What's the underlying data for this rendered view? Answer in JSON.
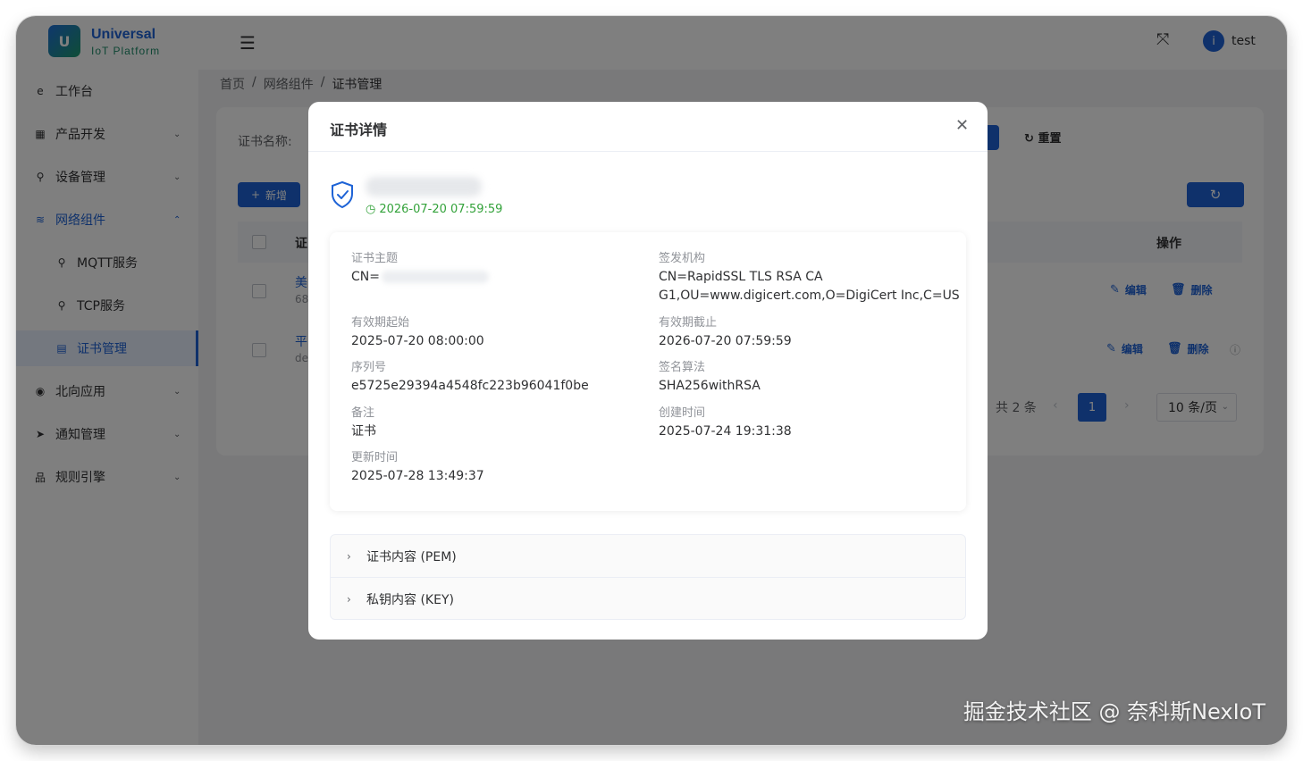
{
  "app": {
    "logo_letter": "U",
    "title": "Universal",
    "subtitle": "IoT Platform"
  },
  "sidebar": {
    "items": [
      {
        "icon": "e",
        "label": "工作台"
      },
      {
        "icon": "▦",
        "label": "产品开发",
        "chevron": "⌄"
      },
      {
        "icon": "⚲",
        "label": "设备管理",
        "chevron": "⌄"
      },
      {
        "icon": "≋",
        "label": "网络组件",
        "chevron": "⌃"
      },
      {
        "icon": "⚲",
        "label": "MQTT服务"
      },
      {
        "icon": "⚲",
        "label": "TCP服务"
      },
      {
        "icon": "▤",
        "label": "证书管理"
      },
      {
        "icon": "◉",
        "label": "北向应用",
        "chevron": "⌄"
      },
      {
        "icon": "➤",
        "label": "通知管理",
        "chevron": "⌄"
      },
      {
        "icon": "品",
        "label": "规则引擎",
        "chevron": "⌄"
      }
    ]
  },
  "header": {
    "menu_icon": "☰",
    "fullscreen_icon": "⤧",
    "avatar_glyph": "i",
    "user": "test"
  },
  "breadcrumb": {
    "items": [
      "首页",
      "网络组件",
      "证书管理"
    ],
    "separator": "/"
  },
  "page": {
    "search_label": "证书名称:",
    "reset_label": "重置",
    "reset_icon": "↻",
    "add_label": "新增",
    "add_icon": "+",
    "refresh_icon": "↻",
    "table": {
      "partial_header": "证",
      "ops_header": "操作",
      "rows": [
        {
          "name_partial": "美",
          "sub_partial": "68"
        },
        {
          "name_partial": "平",
          "sub_partial": "de"
        }
      ],
      "edit_label": "编辑",
      "delete_label": "删除",
      "edit_icon": "✎",
      "delete_icon": "🗑",
      "info_icon": "ⓘ"
    },
    "pagination": {
      "total": "共 2 条",
      "prev": "‹",
      "next": "›",
      "current": "1",
      "page_size": "10 条/页",
      "size_chevron": "⌄"
    }
  },
  "modal": {
    "title": "证书详情",
    "close_icon": "✕",
    "expire_icon": "◷",
    "expire": "2026-07-20 07:59:59",
    "fields": {
      "subject_label": "证书主题",
      "subject_value": "CN=",
      "issuer_label": "签发机构",
      "issuer_line1": "CN=RapidSSL TLS RSA CA",
      "issuer_line2": "G1,OU=www.digicert.com,O=DigiCert Inc,C=US",
      "valid_from_label": "有效期起始",
      "valid_from": "2025-07-20 08:00:00",
      "valid_to_label": "有效期截止",
      "valid_to": "2026-07-20 07:59:59",
      "serial_label": "序列号",
      "serial": "e5725e29394a4548fc223b96041f0be",
      "algo_label": "签名算法",
      "algo": "SHA256withRSA",
      "remark_label": "备注",
      "remark": "证书",
      "created_label": "创建时间",
      "created": "2025-07-24 19:31:38",
      "updated_label": "更新时间",
      "updated": "2025-07-28 13:49:37"
    },
    "collapse": [
      {
        "icon": "›",
        "label": "证书内容 (PEM)"
      },
      {
        "icon": "›",
        "label": "私钥内容 (KEY)"
      }
    ]
  },
  "watermark": "掘金技术社区 @ 奈科斯NexIoT",
  "colors": {
    "primary": "#1e63d6",
    "success": "#33a23a",
    "overlay": "rgba(0,0,0,0.5)"
  }
}
